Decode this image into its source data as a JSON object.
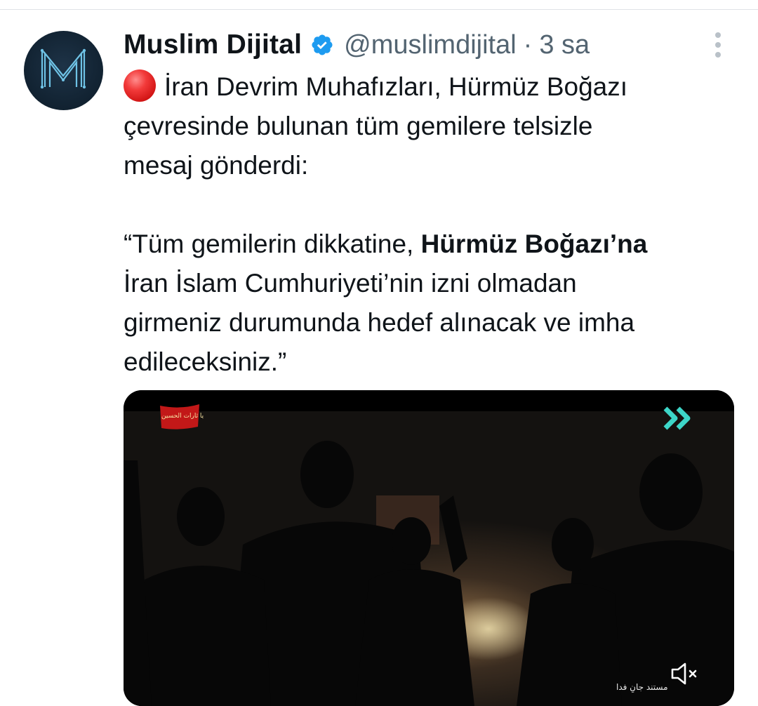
{
  "tweet": {
    "display_name": "Muslim Dijital",
    "handle": "@muslimdijital",
    "separator": "·",
    "timestamp": "3 sa",
    "verified": true,
    "lines": [
      "İran Devrim Muhafızları, Hürmüz Boğazı",
      "çevresinde bulunan tüm gemilere telsizle",
      "mesaj gönderdi:"
    ],
    "quote_line1_normal": "“Tüm gemilerin dikkatine, ",
    "quote_line1_bold": "Hürmüz Boğazı’na",
    "quote_lines": [
      "İran İslam Cumhuriyeti’nin izni olmadan",
      "girmeniz durumunda hedef alınacak ve imha",
      "edileceksiniz.”"
    ],
    "media": {
      "flag_text": "یا ثارات الحسین",
      "watermark_text": "مستند جانِ فدا",
      "muted": true
    }
  },
  "colors": {
    "text": "#0f1419",
    "secondary": "#536471",
    "verified_badge": "#1d9bf0",
    "divider": "#dfe3e6",
    "live_dot": "#e0191a",
    "channel_logo": "#3dd6c8"
  },
  "icons": {
    "avatar": "muslim-dijital-m-logo",
    "verified": "verified-badge-icon",
    "more": "more-vertical-icon",
    "live": "red-circle-emoji",
    "mute": "speaker-mute-icon"
  }
}
